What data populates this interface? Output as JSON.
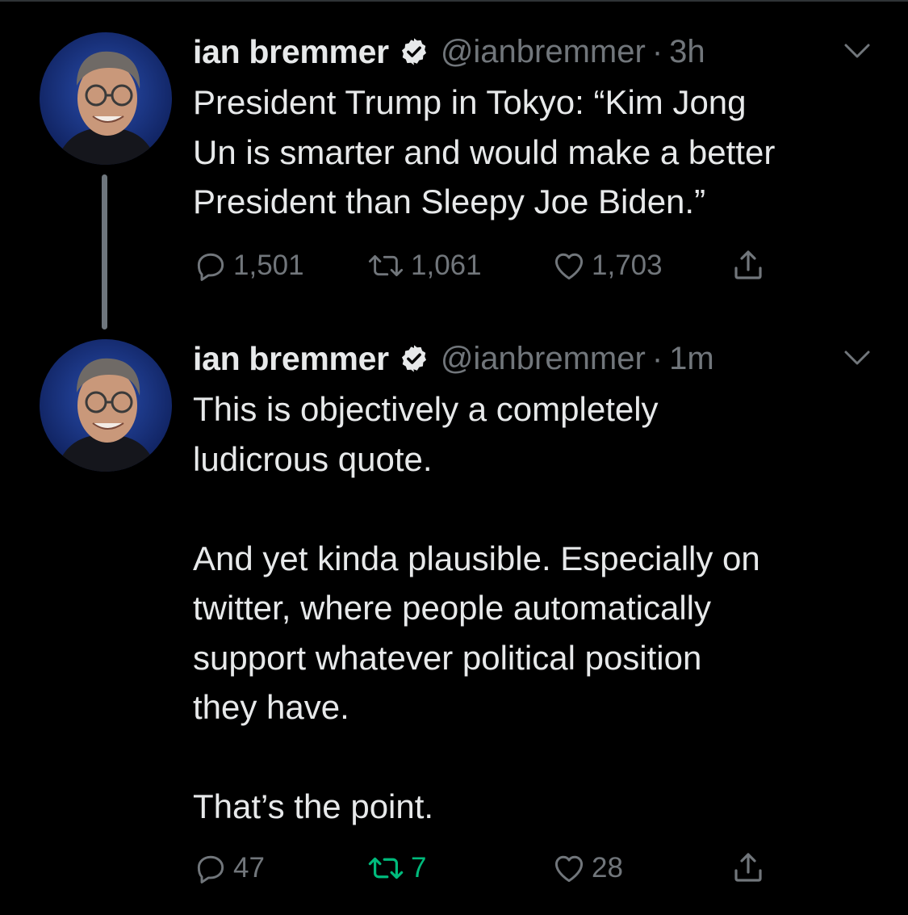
{
  "colors": {
    "background": "#000000",
    "primary_text": "#e7e9ea",
    "secondary_text": "#71767b",
    "retweet_active": "#00ba7c",
    "thread_line": "#6e767d"
  },
  "tweets": [
    {
      "author_name": "ian bremmer",
      "handle": "@ianbremmer",
      "separator": "·",
      "time": "3h",
      "verified_icon": "verified-badge-icon",
      "text": "President Trump in Tokyo: “Kim Jong\nUn is smarter and would make a better\nPresident than Sleepy Joe Biden.”",
      "reply_count": "1,501",
      "retweet_count": "1,061",
      "like_count": "1,703",
      "retweeted": false
    },
    {
      "author_name": "ian bremmer",
      "handle": "@ianbremmer",
      "separator": "·",
      "time": "1m",
      "verified_icon": "verified-badge-icon",
      "text": "This is objectively a completely\nludicrous quote.\n\nAnd yet kinda plausible. Especially on\ntwitter, where people automatically\nsupport whatever political position\nthey have.\n\nThat’s the point.",
      "reply_count": "47",
      "retweet_count": "7",
      "like_count": "28",
      "retweeted": true
    }
  ]
}
